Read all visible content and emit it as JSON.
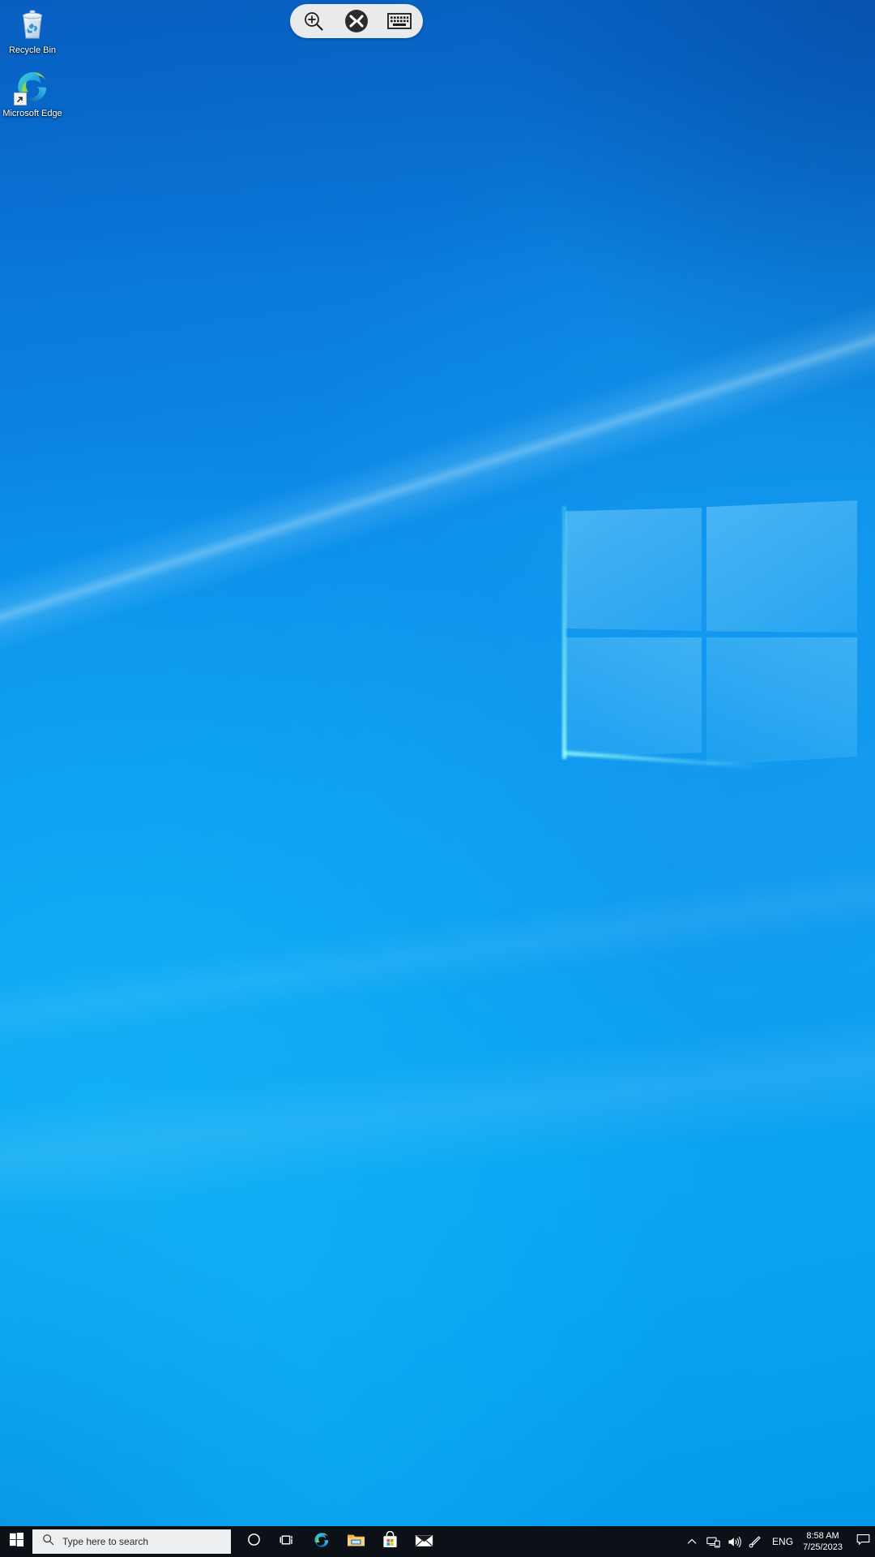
{
  "desktop": {
    "wallpaper_name": "windows-10-hero-wallpaper",
    "accent_blue": "#0a84e0",
    "icons": [
      {
        "name": "recycle-bin",
        "label": "Recycle Bin",
        "has_shortcut_badge": false
      },
      {
        "name": "microsoft-edge",
        "label": "Microsoft Edge",
        "has_shortcut_badge": true
      }
    ]
  },
  "remote_toolbar": {
    "buttons": [
      {
        "name": "zoom-in-icon",
        "title": "Zoom"
      },
      {
        "name": "remote-connection-icon",
        "title": "Remote Desktop"
      },
      {
        "name": "keyboard-icon",
        "title": "Keyboard"
      }
    ]
  },
  "taskbar": {
    "start": {
      "label": "Start",
      "icon": "windows-logo-icon"
    },
    "search": {
      "placeholder": "Type here to search",
      "icon": "search-icon",
      "value": ""
    },
    "cortana": {
      "label": "Cortana",
      "icon": "cortana-circle-icon"
    },
    "task_view": {
      "label": "Task View",
      "icon": "task-view-icon"
    },
    "apps": [
      {
        "name": "microsoft-edge",
        "label": "Microsoft Edge"
      },
      {
        "name": "file-explorer",
        "label": "File Explorer"
      },
      {
        "name": "microsoft-store",
        "label": "Microsoft Store"
      },
      {
        "name": "mail",
        "label": "Mail"
      }
    ],
    "tray": {
      "show_hidden": {
        "name": "chevron-up-icon",
        "label": "Show hidden icons"
      },
      "network": {
        "name": "network-icon",
        "label": "Network"
      },
      "volume": {
        "name": "volume-icon",
        "label": "Volume"
      },
      "pen": {
        "name": "pen-icon",
        "label": "Windows Ink Workspace"
      },
      "language": "ENG",
      "clock": {
        "time": "8:58 AM",
        "date": "7/25/2023"
      },
      "action_center": {
        "name": "action-center-icon",
        "label": "Notifications"
      }
    }
  }
}
